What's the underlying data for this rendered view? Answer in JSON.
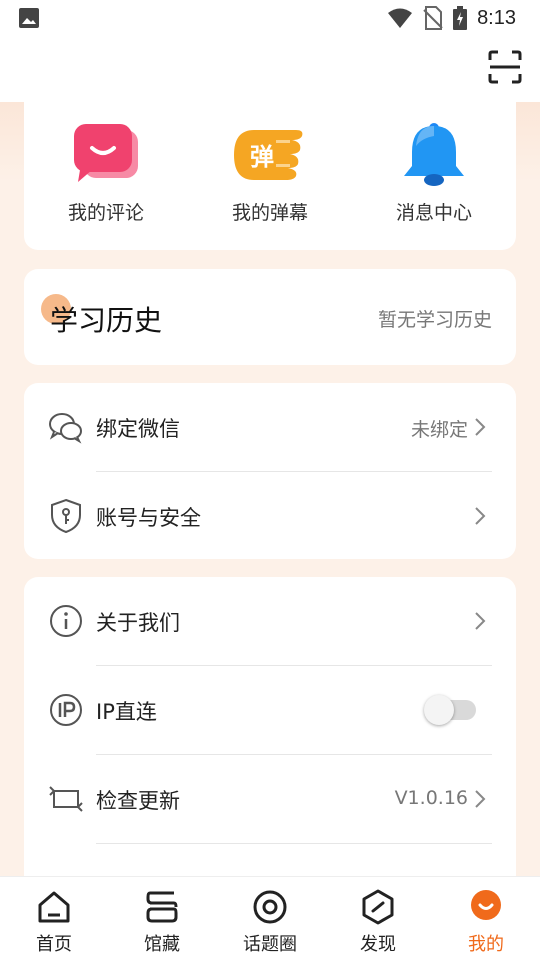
{
  "status_bar": {
    "time": "8:13",
    "icons": [
      "image-icon",
      "wifi-icon",
      "no-sim-icon",
      "battery-icon"
    ]
  },
  "header": {
    "scan_icon": "scan-icon"
  },
  "quick_actions": [
    {
      "label": "我的评论",
      "icon": "comment-icon",
      "color": "#f0426e"
    },
    {
      "label": "我的弹幕",
      "icon": "danmaku-icon",
      "icon_text": "弹",
      "color": "#f5a623"
    },
    {
      "label": "消息中心",
      "icon": "bell-icon",
      "color": "#1e88f5"
    }
  ],
  "history": {
    "title": "学习历史",
    "empty_text": "暂无学习历史"
  },
  "account": {
    "items": [
      {
        "label": "绑定微信",
        "value": "未绑定",
        "icon": "wechat-icon"
      },
      {
        "label": "账号与安全",
        "value": "",
        "icon": "shield-icon"
      }
    ]
  },
  "settings": {
    "items": [
      {
        "label": "关于我们",
        "icon": "info-icon"
      },
      {
        "label": "IP直连",
        "icon": "ip-icon",
        "toggle_on": false
      },
      {
        "label": "检查更新",
        "value": "V1.0.16",
        "icon": "update-icon"
      }
    ]
  },
  "bottom_nav": {
    "items": [
      {
        "label": "首页",
        "icon": "home-icon",
        "active": false
      },
      {
        "label": "馆藏",
        "icon": "collection-icon",
        "active": false
      },
      {
        "label": "话题圈",
        "icon": "topic-circle-icon",
        "active": false
      },
      {
        "label": "发现",
        "icon": "discover-icon",
        "active": false
      },
      {
        "label": "我的",
        "icon": "profile-icon",
        "active": true
      }
    ],
    "active_color": "#f06a1b"
  }
}
